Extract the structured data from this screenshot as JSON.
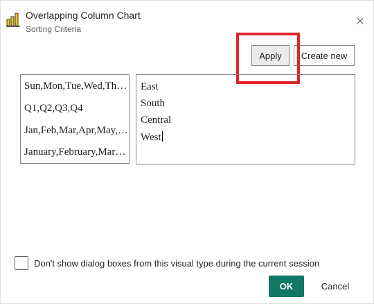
{
  "dialog": {
    "title": "Overlapping Column Chart",
    "subtitle": "Sorting Criteria",
    "app_icon": "bar-chart-icon",
    "close_icon": "close-icon"
  },
  "toolbar": {
    "apply_label": "Apply",
    "create_new_label": "Create new"
  },
  "criteria_list": {
    "items": [
      "Sun,Mon,Tue,Wed,Thu,Fri,Sat",
      "Q1,Q2,Q3,Q4",
      "Jan,Feb,Mar,Apr,May,Jun,Jul,Aug,Sep,Oct,Nov,Dec",
      "January,February,March,April,May,June,July,August,September,October,November,December"
    ]
  },
  "editor": {
    "lines": [
      "East",
      "South",
      "Central",
      "West"
    ]
  },
  "footer": {
    "dont_show_label": "Don't show dialog boxes from this visual type during the current session",
    "dont_show_checked": false,
    "ok_label": "OK",
    "cancel_label": "Cancel"
  },
  "colors": {
    "primary": "#117865",
    "highlight": "#e3242b",
    "icon_yellow": "#f2c811"
  }
}
